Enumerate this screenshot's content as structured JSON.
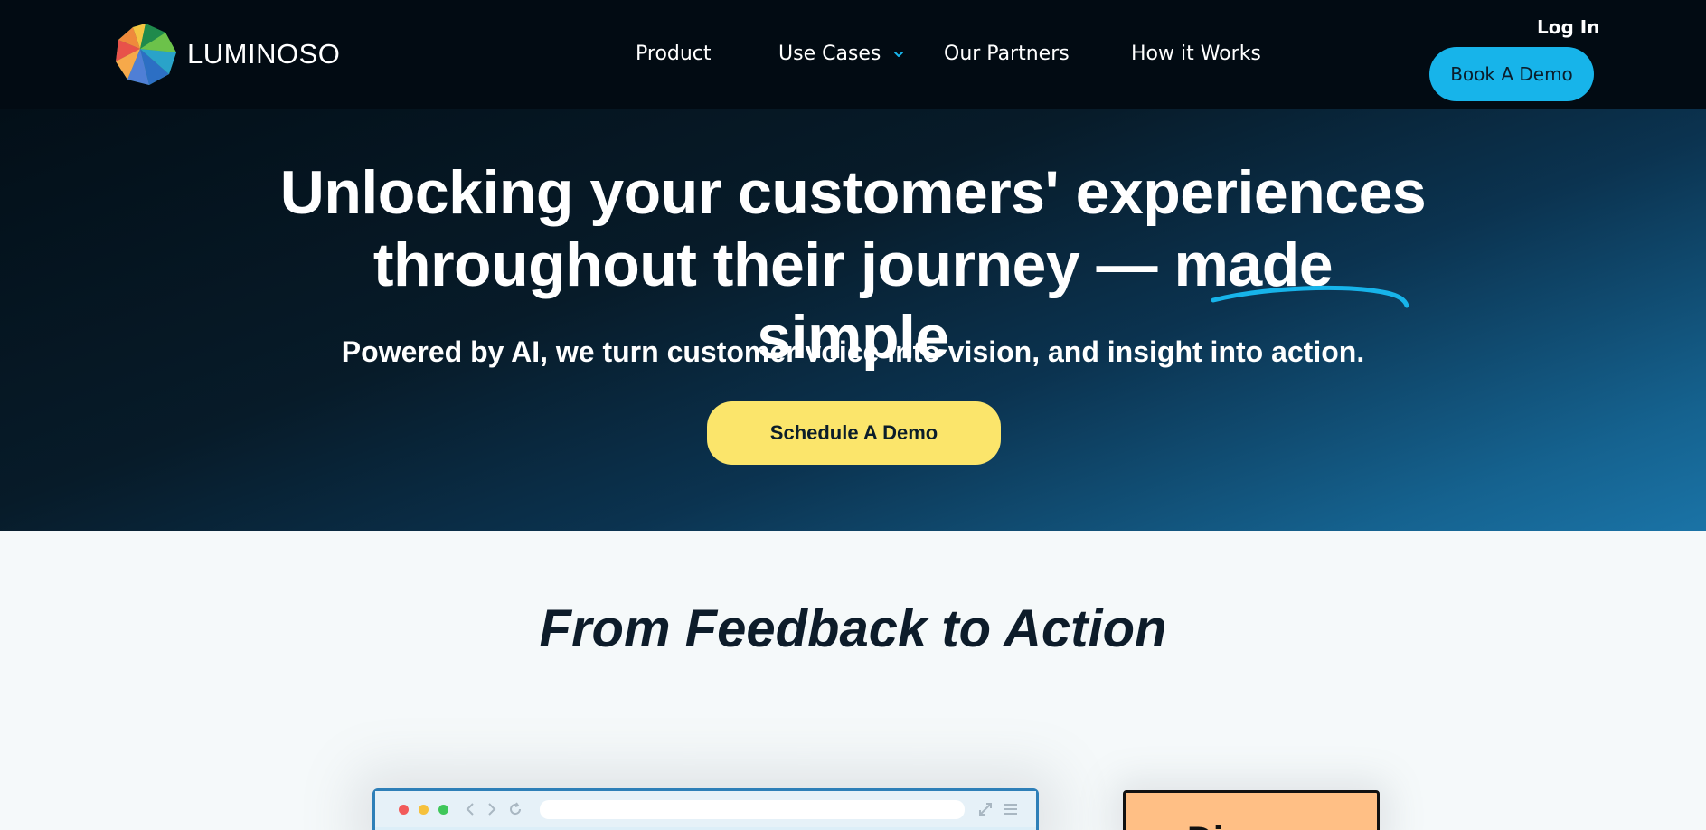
{
  "header": {
    "logo_text": "LUMINOSO",
    "nav": [
      {
        "label": "Product",
        "has_dropdown": false
      },
      {
        "label": "Use Cases",
        "has_dropdown": true
      },
      {
        "label": "Our Partners",
        "has_dropdown": false
      },
      {
        "label": "How it Works",
        "has_dropdown": false
      }
    ],
    "login_label": "Log In",
    "cta_label": "Book A Demo"
  },
  "hero": {
    "title_line1": "Unlocking your customers' experiences",
    "title_line2_prefix": "throughout their journey — made ",
    "title_highlight": "simple",
    "subtitle": "Powered by AI, we turn customer voice into vision, and insight into action.",
    "cta_label": "Schedule A Demo"
  },
  "section": {
    "title": "From Feedback to Action",
    "card_text": "Di"
  },
  "colors": {
    "header_bg": "#020b13",
    "accent_blue": "#17b4ea",
    "cta_yellow": "#fbe56b",
    "card_orange": "#ffbf85",
    "page_bg": "#f5f9fa"
  }
}
